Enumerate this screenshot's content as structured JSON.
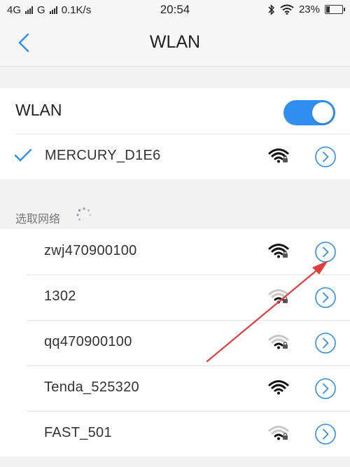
{
  "status_bar": {
    "network_1": "4G",
    "network_2": "G",
    "speed": "0.1K/s",
    "time": "20:54",
    "battery_percent": 23,
    "battery_text": "23%",
    "icons": [
      "signal-icon",
      "bluetooth-icon",
      "wifi-icon",
      "battery-icon"
    ]
  },
  "nav": {
    "back_icon": "chevron-left-icon",
    "title": "WLAN"
  },
  "wlan_toggle": {
    "label": "WLAN",
    "enabled": true
  },
  "connected": {
    "ssid": "MERCURY_D1E6",
    "check_icon": "checkmark-icon",
    "signal_level": 4,
    "secured": true
  },
  "available": {
    "header": "选取网络",
    "loading_icon": "spinner-icon",
    "networks": [
      {
        "ssid": "zwj470900100",
        "signal_level": 4,
        "secured": true
      },
      {
        "ssid": "1302",
        "signal_level": 2,
        "secured": true
      },
      {
        "ssid": "qq470900100",
        "signal_level": 2,
        "secured": true
      },
      {
        "ssid": "Tenda_525320",
        "signal_level": 4,
        "secured": false
      },
      {
        "ssid": "FAST_501",
        "signal_level": 2,
        "secured": true
      }
    ]
  },
  "colors": {
    "accent": "#2f8ef0",
    "annotation_arrow": "#e23c3c",
    "background": "#f2f2f2"
  }
}
